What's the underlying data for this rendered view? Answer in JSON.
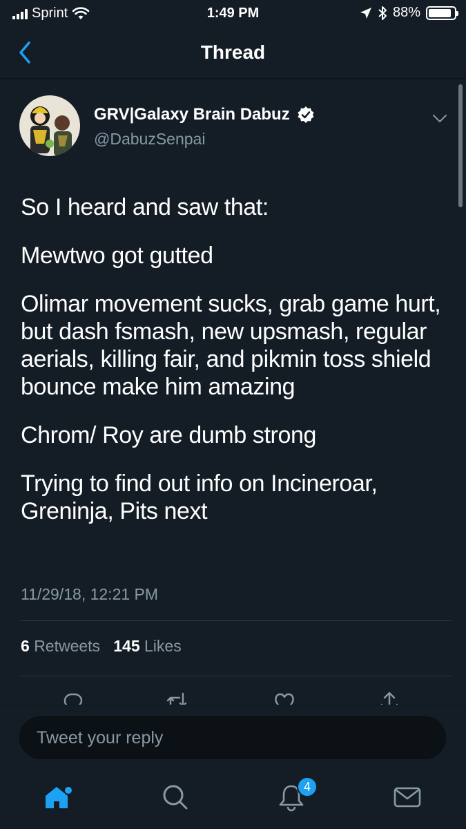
{
  "status_bar": {
    "carrier": "Sprint",
    "time": "1:49 PM",
    "battery_percent": "88%",
    "battery_level": 0.88,
    "icons": [
      "signal-icon",
      "wifi-icon",
      "location-icon",
      "bluetooth-icon",
      "battery-icon"
    ]
  },
  "nav": {
    "title": "Thread",
    "back_icon": "chevron-left-icon"
  },
  "tweet": {
    "author_name": "GRV|Galaxy Brain Dabuz",
    "handle": "@DabuzSenpai",
    "verified_icon": "verified-badge-icon",
    "paragraphs": [
      "So I heard and saw that:",
      "Mewtwo got gutted",
      "Olimar movement sucks, grab game hurt, but dash fsmash, new upsmash, regular aerials, killing fair, and pikmin toss shield bounce make him amazing",
      "Chrom/ Roy are dumb strong",
      "Trying to find out info on Incineroar, Greninja, Pits next"
    ],
    "timestamp": "11/29/18, 12:21 PM",
    "retweets_count": "6",
    "retweets_label": "Retweets",
    "likes_count": "145",
    "likes_label": "Likes"
  },
  "reply": {
    "placeholder": "Tweet your reply"
  },
  "tabs": {
    "notifications_badge": "4",
    "items": [
      "home-icon",
      "search-icon",
      "notifications-icon",
      "messages-icon"
    ]
  },
  "colors": {
    "background": "#141d26",
    "secondary_text": "#8899a6",
    "accent": "#1da1f2"
  }
}
